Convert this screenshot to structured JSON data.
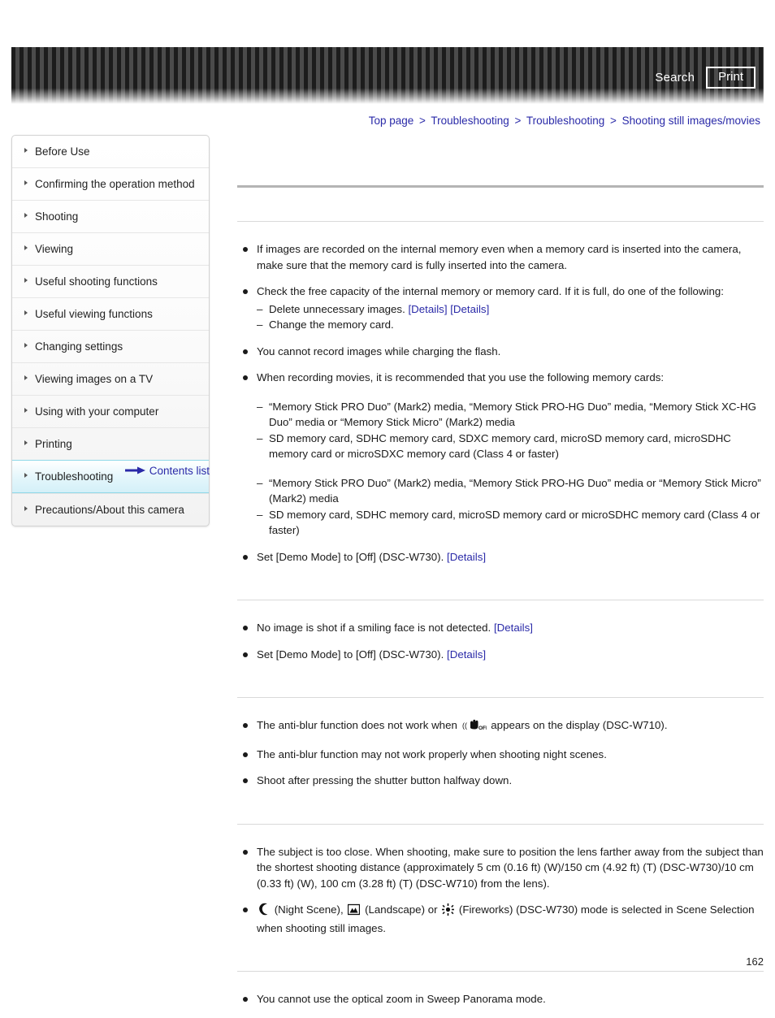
{
  "header": {
    "search_label": "Search",
    "print_label": "Print"
  },
  "breadcrumb": {
    "items": [
      {
        "label": "Top page"
      },
      {
        "label": "Troubleshooting"
      },
      {
        "label": "Troubleshooting"
      },
      {
        "label": "Shooting still images/movies"
      }
    ],
    "separator": ">"
  },
  "sidebar": {
    "items": [
      {
        "label": "Before Use",
        "active": false
      },
      {
        "label": "Confirming the operation method",
        "active": false
      },
      {
        "label": "Shooting",
        "active": false
      },
      {
        "label": "Viewing",
        "active": false
      },
      {
        "label": "Useful shooting functions",
        "active": false
      },
      {
        "label": "Useful viewing functions",
        "active": false
      },
      {
        "label": "Changing settings",
        "active": false
      },
      {
        "label": "Viewing images on a TV",
        "active": false
      },
      {
        "label": "Using with your computer",
        "active": false
      },
      {
        "label": "Printing",
        "active": false
      },
      {
        "label": "Troubleshooting",
        "active": true
      },
      {
        "label": "Precautions/About this camera",
        "active": false
      }
    ],
    "contents_list_label": "Contents list"
  },
  "main": {
    "section1": {
      "title": "",
      "b1": "If images are recorded on the internal memory even when a memory card is inserted into the camera, make sure that the memory card is fully inserted into the camera.",
      "b2": "Check the free capacity of the internal memory or memory card. If it is full, do one of the following:",
      "b2_d1_text": "Delete unnecessary images. ",
      "b2_d1_link1": "[Details]",
      "b2_d1_link2": "[Details]",
      "b2_d2": "Change the memory card.",
      "b3": "You cannot record images while charging the flash.",
      "b4": "When recording movies, it is recommended that you use the following memory cards:",
      "b4_d1": "“Memory Stick PRO Duo” (Mark2) media, “Memory Stick PRO-HG Duo” media, “Memory Stick XC-HG Duo” media or “Memory Stick Micro” (Mark2) media",
      "b4_d2": "SD memory card, SDHC memory card, SDXC memory card, microSD memory card, microSDHC memory card or microSDXC memory card (Class 4 or faster)",
      "b4_d3": "“Memory Stick PRO Duo” (Mark2) media, “Memory Stick PRO-HG Duo” media or “Memory Stick Micro” (Mark2) media",
      "b4_d4": "SD memory card, SDHC memory card, microSD memory card or microSDHC memory card (Class 4 or faster)",
      "b5_text": "Set [Demo Mode] to [Off] (DSC-W730). ",
      "b5_link": "[Details]"
    },
    "section2": {
      "title": "",
      "b1_text": "No image is shot if a smiling face is not detected. ",
      "b1_link": "[Details]",
      "b2_text": "Set [Demo Mode] to [Off] (DSC-W730). ",
      "b2_link": "[Details]"
    },
    "section3": {
      "title": "",
      "b1_pre": "The anti-blur function does not work when ",
      "b1_icon": "anti-blur-off-icon",
      "b1_post": " appears on the display (DSC-W710).",
      "b2": "The anti-blur function may not work properly when shooting night scenes.",
      "b3": "Shoot after pressing the shutter button halfway down."
    },
    "section4": {
      "title": "",
      "b1": "The subject is too close. When shooting, make sure to position the lens farther away from the subject than the shortest shooting distance (approximately 5 cm (0.16 ft) (W)/150 cm (4.92 ft) (T) (DSC-W730)/10 cm (0.33 ft) (W), 100 cm (3.28 ft) (T) (DSC-W710) from the lens).",
      "b2_icon1": "night-scene-moon-icon",
      "b2_t1": " (Night Scene), ",
      "b2_icon2": "landscape-icon",
      "b2_t2": " (Landscape) or ",
      "b2_icon3": "fireworks-icon",
      "b2_t3": " (Fireworks) (DSC-W730) mode is selected in Scene Selection when shooting still images."
    },
    "section5": {
      "title": "",
      "b1": "You cannot use the optical zoom in Sweep Panorama mode."
    }
  },
  "footer": {
    "page_number": "162"
  },
  "colors": {
    "link": "#2a2aa8",
    "active_nav_bg": "#d4f0f8",
    "active_nav_border": "#8fd8e8",
    "banner_dark": "#1c1c1c",
    "banner_light": "#4b4b4b"
  }
}
